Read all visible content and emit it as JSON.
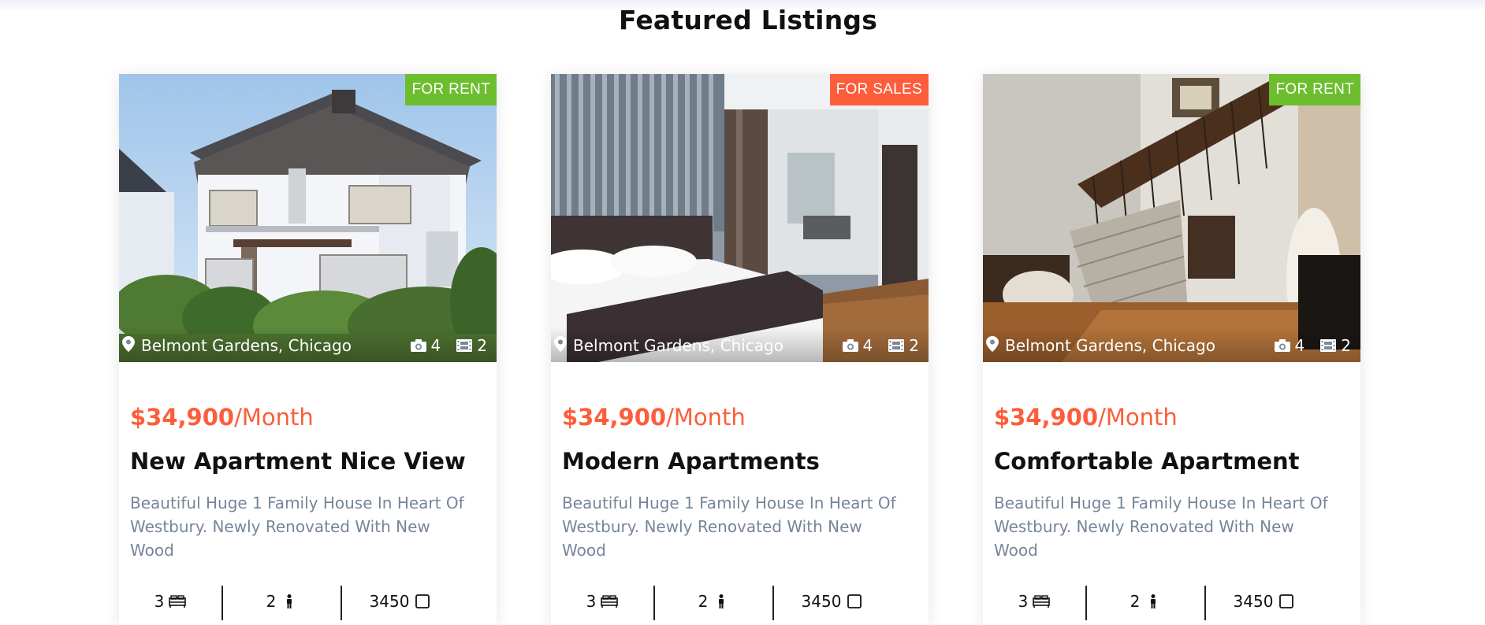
{
  "section": {
    "title": "Featured Listings"
  },
  "listings": [
    {
      "tag": "FOR RENT",
      "tag_color": "#6dbe2f",
      "location": "Belmont Gardens, Chicago",
      "photos": "4",
      "videos": "2",
      "price_amount": "$34,900",
      "price_period": "/Month",
      "title": "New Apartment Nice View",
      "description": "Beautiful Huge 1 Family House In Heart Of Westbury. Newly Renovated With New Wood",
      "beds": "3",
      "baths": "2",
      "area": "3450"
    },
    {
      "tag": "FOR SALES",
      "tag_color": "#fd5d3b",
      "location": "Belmont Gardens, Chicago",
      "photos": "4",
      "videos": "2",
      "price_amount": "$34,900",
      "price_period": "/Month",
      "title": "Modern Apartments",
      "description": "Beautiful Huge 1 Family House In Heart Of Westbury. Newly Renovated With New Wood",
      "beds": "3",
      "baths": "2",
      "area": "3450"
    },
    {
      "tag": "FOR RENT",
      "tag_color": "#6dbe2f",
      "location": "Belmont Gardens, Chicago",
      "photos": "4",
      "videos": "2",
      "price_amount": "$34,900",
      "price_period": "/Month",
      "title": "Comfortable Apartment",
      "description": "Beautiful Huge 1 Family House In Heart Of Westbury. Newly Renovated With New Wood",
      "beds": "3",
      "baths": "2",
      "area": "3450"
    }
  ],
  "icons": {
    "location": "map-pin-icon",
    "photos": "camera-icon",
    "videos": "film-icon",
    "beds": "bed-icon",
    "baths": "person-icon",
    "area": "square-icon"
  },
  "colors": {
    "accent": "#fd5d3b",
    "rent_tag": "#6dbe2f",
    "sale_tag": "#fd5d3b",
    "description_text": "#76859a"
  }
}
